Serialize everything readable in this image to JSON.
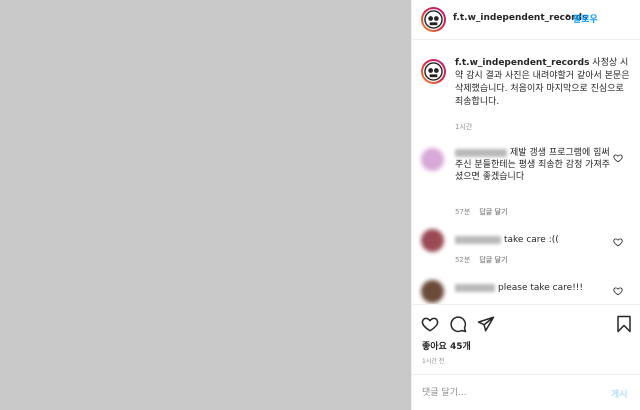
{
  "post": {
    "username": "f.t.w_independent_records",
    "header_username_display": "f.t.w_independent_records",
    "follow_separator": "•",
    "follow_label": "팔로우",
    "caption_text": " 사정상 시약 감시 결과 사진은 내려야할거 같아서 본문은 삭제했습니다. 처음이자 마지막으로 진심으로 죄송합니다.",
    "caption_time": "1시간"
  },
  "comments": [
    {
      "text": "제발 갱생 프로그램에 힘써주신 분들한테는 평생 죄송한 감정 가져주셨으면 좋겠습니다",
      "time": "57분",
      "reply_label": "답글 달기"
    },
    {
      "text": "take care :((",
      "time": "52분",
      "reply_label": "답글 달기"
    },
    {
      "text": "please take care!!!",
      "time": "",
      "reply_label": ""
    }
  ],
  "actions": {
    "icons": [
      "heart-icon",
      "comment-icon",
      "share-icon",
      "bookmark-icon"
    ],
    "likes": "좋아요 45개",
    "post_time": "1시간 전"
  },
  "comment_box": {
    "placeholder": "댓글 달기...",
    "post_label": "게시"
  },
  "colors": {
    "media_background": "#c9c9c9",
    "link_blue": "#0095f6",
    "post_disabled": "#b2dffc",
    "secondary_text": "#8e8e8e"
  }
}
